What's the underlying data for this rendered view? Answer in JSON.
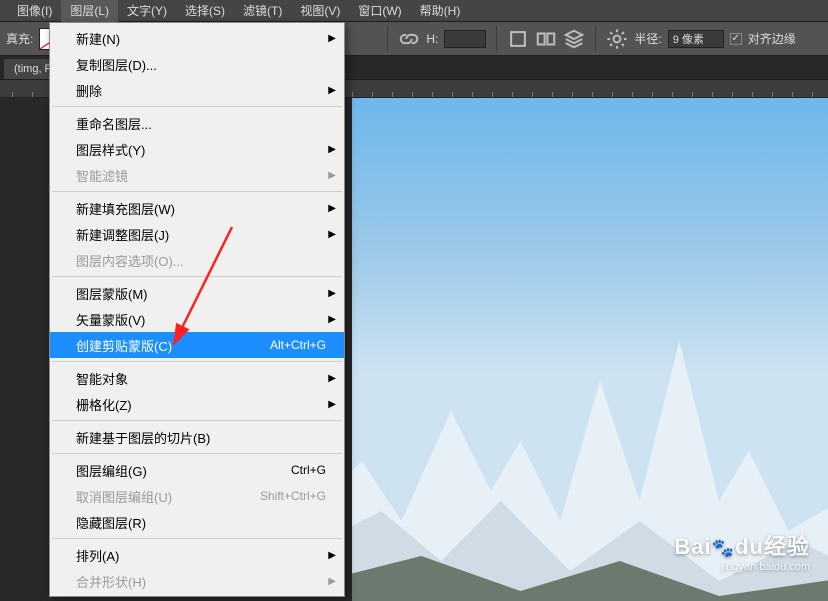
{
  "menubar": {
    "items": [
      {
        "label": "图像(I)"
      },
      {
        "label": "图层(L)",
        "open": true
      },
      {
        "label": "文字(Y)"
      },
      {
        "label": "选择(S)"
      },
      {
        "label": "滤镜(T)"
      },
      {
        "label": "视图(V)"
      },
      {
        "label": "窗口(W)"
      },
      {
        "label": "帮助(H)"
      }
    ]
  },
  "toolbar": {
    "fill_label": "真充:",
    "h_label": "H:",
    "radius_label": "半径:",
    "radius_value": "9 像素",
    "align_edges_label": "对齐边缘"
  },
  "tab": {
    "title": "(timg, RG"
  },
  "dropdown": {
    "items": [
      {
        "label": "新建(N)",
        "submenu": true
      },
      {
        "label": "复制图层(D)..."
      },
      {
        "label": "删除",
        "submenu": true
      },
      {
        "sep": true
      },
      {
        "label": "重命名图层..."
      },
      {
        "label": "图层样式(Y)",
        "submenu": true
      },
      {
        "label": "智能滤镜",
        "submenu": true,
        "disabled": true
      },
      {
        "sep": true
      },
      {
        "label": "新建填充图层(W)",
        "submenu": true
      },
      {
        "label": "新建调整图层(J)",
        "submenu": true
      },
      {
        "label": "图层内容选项(O)...",
        "disabled": true
      },
      {
        "sep": true
      },
      {
        "label": "图层蒙版(M)",
        "submenu": true
      },
      {
        "label": "矢量蒙版(V)",
        "submenu": true
      },
      {
        "label": "创建剪贴蒙版(C)",
        "shortcut": "Alt+Ctrl+G",
        "highlighted": true
      },
      {
        "sep": true
      },
      {
        "label": "智能对象",
        "submenu": true
      },
      {
        "label": "栅格化(Z)",
        "submenu": true
      },
      {
        "sep": true
      },
      {
        "label": "新建基于图层的切片(B)"
      },
      {
        "sep": true
      },
      {
        "label": "图层编组(G)",
        "shortcut": "Ctrl+G"
      },
      {
        "label": "取消图层编组(U)",
        "shortcut": "Shift+Ctrl+G",
        "disabled": true
      },
      {
        "label": "隐藏图层(R)"
      },
      {
        "sep": true
      },
      {
        "label": "排列(A)",
        "submenu": true
      },
      {
        "label": "合并形状(H)",
        "submenu": true,
        "disabled": true
      }
    ]
  },
  "watermark": {
    "brand": "Bai",
    "brand2": "du",
    "brand3": "经验",
    "url": "jingyan.baidu.com"
  }
}
